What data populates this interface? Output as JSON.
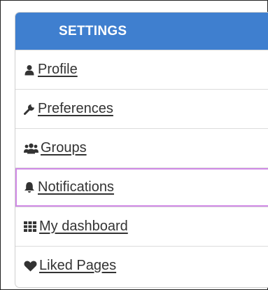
{
  "settings": {
    "header_title": "SETTINGS",
    "items": [
      {
        "label": "Profile",
        "icon": "user-icon"
      },
      {
        "label": "Preferences",
        "icon": "wrench-icon"
      },
      {
        "label": "Groups",
        "icon": "users-icon"
      },
      {
        "label": "Notifications",
        "icon": "bell-icon",
        "highlighted": true
      },
      {
        "label": "My dashboard",
        "icon": "grid-icon"
      },
      {
        "label": "Liked Pages",
        "icon": "heart-icon"
      }
    ]
  },
  "colors": {
    "header_bg": "#3f7fcf",
    "highlight_border": "#d08ae6",
    "text": "#333333"
  }
}
